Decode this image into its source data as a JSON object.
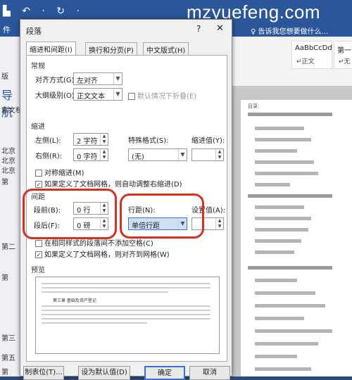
{
  "watermark": "mzyuefeng.com",
  "titlebar": {
    "quick_access": "▙ ↶ · ↻ ·",
    "file_tab": "件",
    "search_hint": "♀ 告诉我您想要做什么..."
  },
  "ribbon": {
    "styles": [
      {
        "preview": "AaBbCcDd",
        "name": "↵正文"
      },
      {
        "preview": "第一",
        "name": "↵无"
      }
    ]
  },
  "nav": {
    "title": "导航",
    "subtitle": "索文档",
    "labels": [
      "版",
      "北京",
      "北京",
      "北京",
      "第",
      "第二",
      "第",
      "第三",
      "第五",
      "第"
    ]
  },
  "dialog": {
    "title": "段落",
    "help": "?",
    "close": "✕",
    "tabs": [
      "缩进和间距(I)",
      "换行和分页(P)",
      "中文版式(H)"
    ],
    "general": {
      "section": "常规",
      "alignment_label": "对齐方式(G):",
      "alignment_value": "左对齐",
      "outline_label": "大纲级别(O):",
      "outline_value": "正文文本",
      "collapsed_default": "默认情况下折叠(E)"
    },
    "indent": {
      "section": "缩进",
      "left_label": "左侧(L):",
      "left_value": "2 字符",
      "right_label": "右侧(R):",
      "right_value": "0 字符",
      "special_label": "特殊格式(S):",
      "special_value": "(无)",
      "indent_by_label": "缩进值(Y):",
      "indent_by_value": "",
      "mirror": "对称缩进(M)",
      "auto_adjust": "如果定义了文档网格，则自动调整右缩进(D)"
    },
    "spacing": {
      "section": "间距",
      "before_label": "段前(B):",
      "before_value": "0 行",
      "after_label": "段后(F):",
      "after_value": "0 磅",
      "line_label": "行距(N):",
      "line_value": "单倍行距",
      "at_label": "设置值(A):",
      "at_value": "",
      "no_space_same_style": "在相同样式的段落间不添加空格(C)",
      "snap_to_grid": "如果定义了文档网格，则对齐到网格(W)"
    },
    "preview": {
      "section": "预览",
      "sample_heading": "第三章 基础及资产登记"
    },
    "buttons": {
      "tabs": "制表位(T)...",
      "default": "设为默认值(D)",
      "ok": "确定",
      "cancel": "取消"
    }
  },
  "document": {
    "toc_label": "目录："
  },
  "colors": {
    "ribbon": "#2b579a",
    "annotation": "#d83020",
    "highlight": "#3a6fd8"
  }
}
